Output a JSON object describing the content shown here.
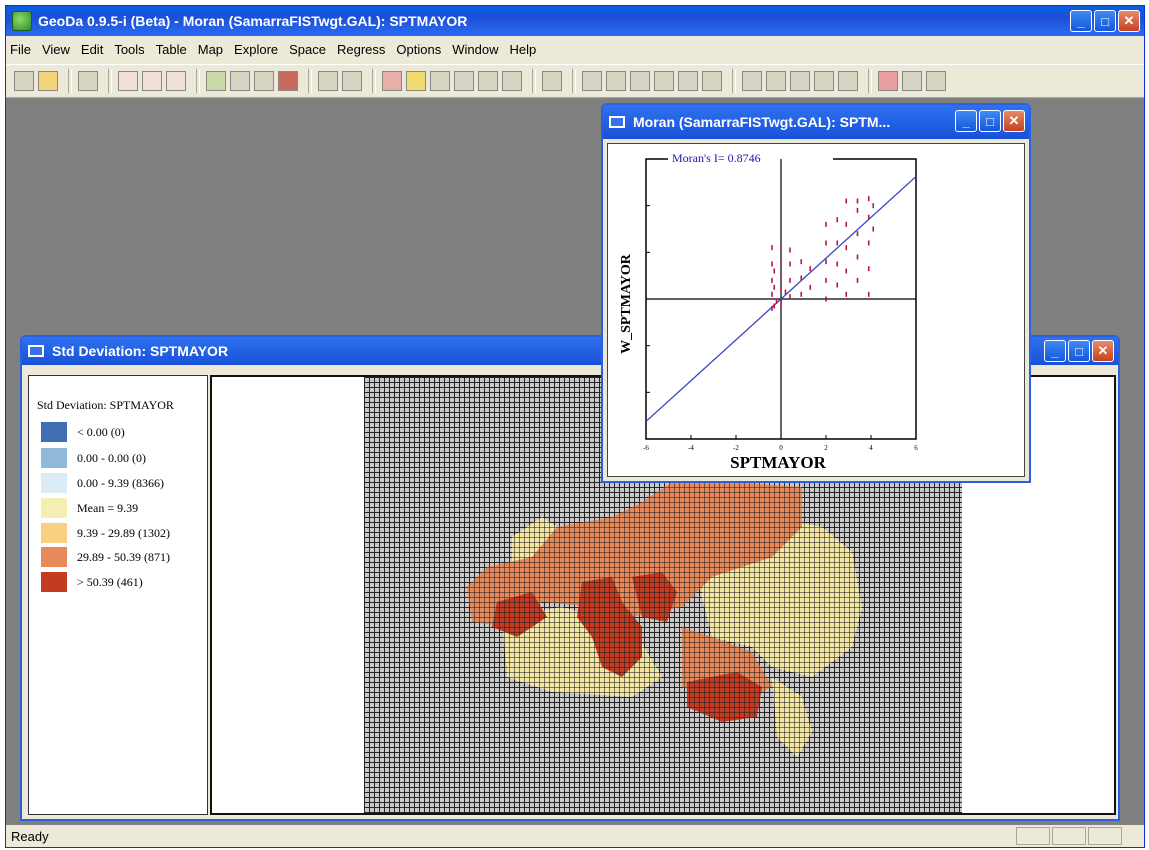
{
  "app": {
    "title": "GeoDa 0.9.5-i (Beta) - Moran (SamarraFISTwgt.GAL): SPTMAYOR",
    "status": "Ready"
  },
  "menu": [
    "File",
    "View",
    "Edit",
    "Tools",
    "Table",
    "Map",
    "Explore",
    "Space",
    "Regress",
    "Options",
    "Window",
    "Help"
  ],
  "std_window": {
    "title": "Std Deviation: SPTMAYOR",
    "legend_title": "Std Deviation: SPTMAYOR",
    "legend": [
      {
        "label": "<  0.00 (0)",
        "color": "#3f6fb3"
      },
      {
        "label": "0.00 -  0.00 (0)",
        "color": "#8fb8d9"
      },
      {
        "label": "0.00 -  9.39 (8366)",
        "color": "#dcecf6"
      },
      {
        "label": "Mean =  9.39",
        "color": "#f6efb4"
      },
      {
        "label": "9.39 -  29.89 (1302)",
        "color": "#f7d080"
      },
      {
        "label": "29.89 -  50.39 (871)",
        "color": "#e8895a"
      },
      {
        "label": ">  50.39 (461)",
        "color": "#c23b22"
      }
    ]
  },
  "moran_window": {
    "title": "Moran (SamarraFISTwgt.GAL): SPTM...",
    "chart_data": {
      "type": "scatter",
      "title": "Moran's I= 0.8746",
      "xlabel": "SPTMAYOR",
      "ylabel": "W_SPTMAYOR",
      "xlim": [
        -6,
        6
      ],
      "ylim": [
        -6,
        6
      ],
      "x_ticks": [
        "-6",
        "-4",
        "-2",
        "0",
        "2",
        "4",
        "6"
      ],
      "regression_slope": 0.8746,
      "points": [
        [
          -0.4,
          -0.4
        ],
        [
          -0.4,
          0.2
        ],
        [
          -0.4,
          0.8
        ],
        [
          -0.4,
          1.5
        ],
        [
          -0.4,
          2.2
        ],
        [
          -0.3,
          -0.3
        ],
        [
          -0.3,
          0.5
        ],
        [
          -0.3,
          1.2
        ],
        [
          0.0,
          -0.2
        ],
        [
          0.0,
          0.4
        ],
        [
          0.0,
          1.0
        ],
        [
          0.0,
          1.6
        ],
        [
          0.0,
          2.2
        ],
        [
          0.4,
          0.1
        ],
        [
          0.4,
          0.8
        ],
        [
          0.4,
          1.5
        ],
        [
          0.4,
          2.1
        ],
        [
          0.9,
          0.2
        ],
        [
          0.9,
          0.9
        ],
        [
          0.9,
          1.6
        ],
        [
          1.3,
          0.5
        ],
        [
          1.3,
          1.3
        ],
        [
          2.0,
          0.0
        ],
        [
          2.0,
          0.8
        ],
        [
          2.0,
          1.6
        ],
        [
          2.0,
          2.4
        ],
        [
          2.0,
          3.2
        ],
        [
          2.5,
          0.6
        ],
        [
          2.5,
          1.5
        ],
        [
          2.5,
          2.4
        ],
        [
          2.5,
          3.4
        ],
        [
          2.9,
          0.2
        ],
        [
          2.9,
          1.2
        ],
        [
          2.9,
          2.2
        ],
        [
          2.9,
          3.2
        ],
        [
          2.9,
          4.2
        ],
        [
          3.4,
          0.8
        ],
        [
          3.4,
          1.8
        ],
        [
          3.4,
          2.8
        ],
        [
          3.4,
          3.8
        ],
        [
          3.4,
          4.2
        ],
        [
          3.9,
          0.2
        ],
        [
          3.9,
          1.3
        ],
        [
          3.9,
          2.4
        ],
        [
          3.9,
          3.5
        ],
        [
          3.9,
          4.3
        ],
        [
          4.1,
          3.0
        ],
        [
          4.1,
          4.0
        ],
        [
          -0.2,
          -0.1
        ],
        [
          0.2,
          0.3
        ]
      ]
    }
  }
}
